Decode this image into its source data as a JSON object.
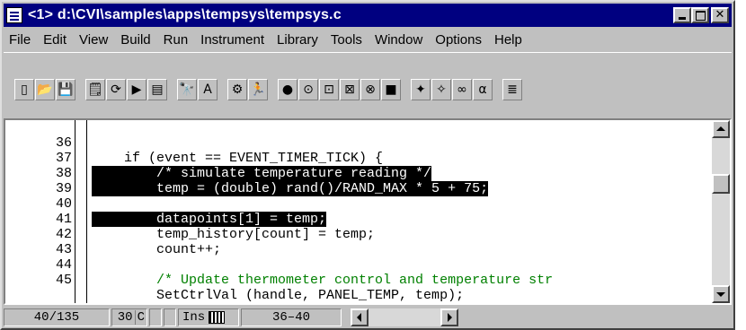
{
  "window": {
    "title": "<1> d:\\CVI\\samples\\apps\\tempsys\\tempsys.c",
    "title_icon": "document-icon",
    "controls": [
      "minimize",
      "maximize",
      "close"
    ]
  },
  "menu": [
    "File",
    "Edit",
    "View",
    "Build",
    "Run",
    "Instrument",
    "Library",
    "Tools",
    "Window",
    "Options",
    "Help"
  ],
  "toolbar_glyphs": {
    "new": "▯",
    "open": "📂",
    "save": "💾",
    "edit_ui": "🗒",
    "recompile": "⟳",
    "run": "▶",
    "window": "▤",
    "find": "🔭",
    "replace": "A",
    "build": "⚙",
    "run_project": "🏃",
    "go": "●",
    "step_over": "⊙",
    "step_into": "⊡",
    "step_out": "⊠",
    "break": "⊗",
    "stop": "■",
    "toggle_breakpoint": "✦",
    "breakpoints": "✧",
    "variables": "∞",
    "watch": "α",
    "function_tree": "≣"
  },
  "editor": {
    "lines": [
      {
        "num": "36",
        "code": "    if (event == EVENT_TIMER_TICK) {"
      },
      {
        "num": "37",
        "code": "        /* simulate temperature reading */"
      },
      {
        "num": "38",
        "code": "        temp = (double) rand()/RAND_MAX * 5 + 75;"
      },
      {
        "num": "39",
        "code": ""
      },
      {
        "num": "40",
        "code": "        datapoints[1] = temp;"
      },
      {
        "num": "41",
        "code": "        temp_history[count] = temp;"
      },
      {
        "num": "42",
        "code": "        count++;"
      },
      {
        "num": "43",
        "code": ""
      },
      {
        "num": "44",
        "code": "        /* Update thermometer control and temperature str"
      },
      {
        "num": "45",
        "code": "        SetCtrlVal (handle, PANEL_TEMP, temp);"
      }
    ]
  },
  "status": {
    "line_info": "40/135",
    "column": "30",
    "col_flag": "C",
    "insert_mode": "Ins",
    "selection": "36–40"
  },
  "colors": {
    "title_bg": "#000080",
    "selection_bg": "#000000",
    "keyword": "#000080",
    "comment": "#008000",
    "type_keyword": "#808000"
  }
}
